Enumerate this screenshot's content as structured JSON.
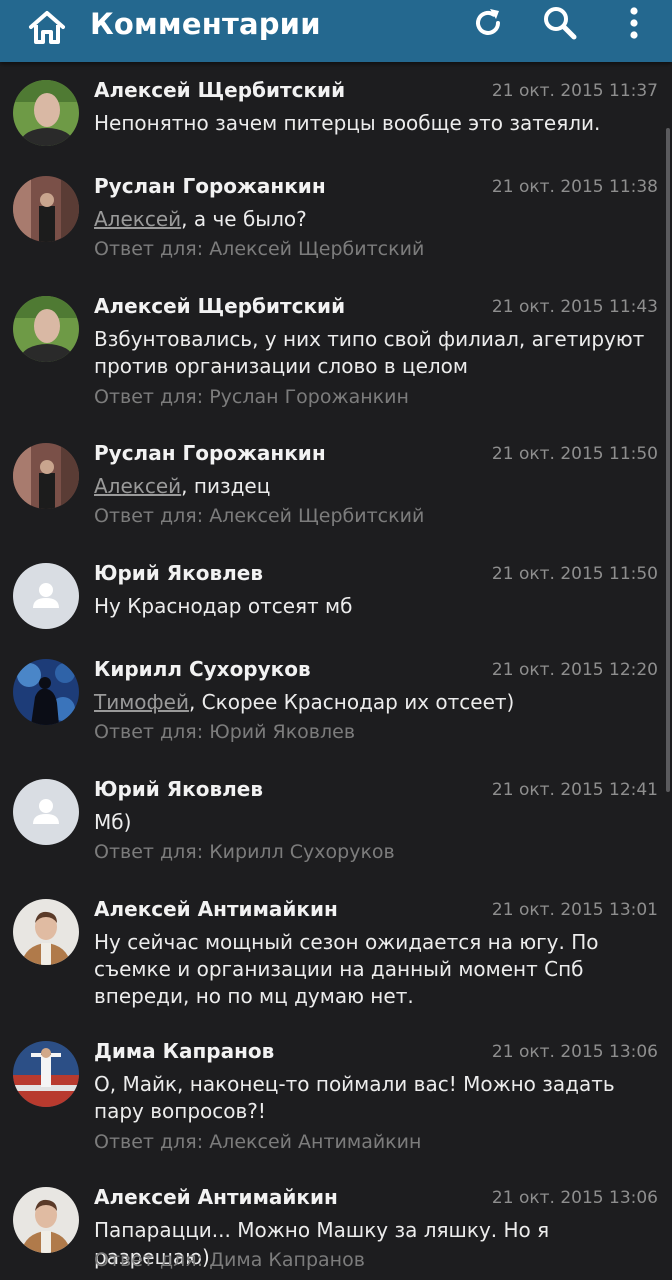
{
  "header": {
    "title": "Комментарии",
    "icons": [
      "home-icon",
      "refresh-icon",
      "search-icon",
      "more-vertical-icon"
    ],
    "color": "#24688f"
  },
  "reply_prefix": "Ответ для:",
  "comments": [
    {
      "author": "Алексей Щербитский",
      "time": "21 окт. 2015 11:37",
      "mention": "",
      "text": "Непонятно зачем питерцы вообще это затеяли.",
      "reply_to": ""
    },
    {
      "author": "Руслан Горожанкин",
      "time": "21 окт. 2015 11:38",
      "mention": "Алексей",
      "text": ", а че было?",
      "reply_to": "Алексей Щербитский"
    },
    {
      "author": "Алексей Щербитский",
      "time": "21 окт. 2015 11:43",
      "mention": "",
      "text": "Взбунтовались, у них типо свой филиал, агетируют против организации слово в целом",
      "reply_to": "Руслан Горожанкин"
    },
    {
      "author": "Руслан Горожанкин",
      "time": "21 окт. 2015 11:50",
      "mention": "Алексей",
      "text": ", пиздец",
      "reply_to": "Алексей Щербитский"
    },
    {
      "author": "Юрий Яковлев",
      "time": "21 окт. 2015 11:50",
      "mention": "",
      "text": "Ну Краснодар отсеят мб",
      "reply_to": ""
    },
    {
      "author": "Кирилл Сухоруков",
      "time": "21 окт. 2015 12:20",
      "mention": "Тимофей",
      "text": ", Скорее Краснодар их отсеет)",
      "reply_to": "Юрий Яковлев"
    },
    {
      "author": "Юрий Яковлев",
      "time": "21 окт. 2015 12:41",
      "mention": "",
      "text": "Мб)",
      "reply_to": "Кирилл Сухоруков"
    },
    {
      "author": "Алексей Антимайкин",
      "time": "21 окт. 2015 13:01",
      "mention": "",
      "text": "Ну сейчас мощный сезон ожидается на югу. По съемке и организации на данный момент Спб впереди, но по мц думаю нет.",
      "reply_to": ""
    },
    {
      "author": "Дима Капранов",
      "time": "21 окт. 2015 13:06",
      "mention": "",
      "text": "О, Майк, наконец-то поймали вас! Можно задать пару вопросов?!",
      "reply_to": "Алексей Антимайкин"
    },
    {
      "author": "Алексей Антимайкин",
      "time": "21 окт. 2015 13:06",
      "mention": "",
      "text": "Папарацци... Можно Машку за ляшку. Но я разрешаю)",
      "reply_to": "Дима Капранов"
    }
  ]
}
